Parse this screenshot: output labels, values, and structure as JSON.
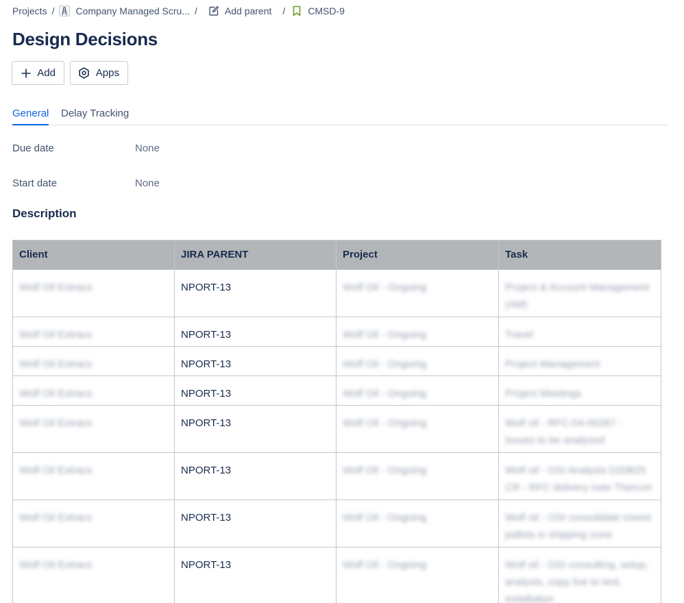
{
  "breadcrumb": {
    "projects": "Projects",
    "project_name": "Company Managed Scru...",
    "add_parent": "Add parent",
    "issue_key": "CMSD-9"
  },
  "page": {
    "title": "Design Decisions"
  },
  "toolbar": {
    "add_label": "Add",
    "apps_label": "Apps"
  },
  "tabs": [
    {
      "label": "General",
      "active": true
    },
    {
      "label": "Delay Tracking",
      "active": false
    }
  ],
  "fields": {
    "due_date": {
      "label": "Due date",
      "value": "None"
    },
    "start_date": {
      "label": "Start date",
      "value": "None"
    }
  },
  "description": {
    "heading": "Description",
    "table": {
      "headers": [
        "Client",
        "JIRA PARENT",
        "Project",
        "Task"
      ],
      "rows": [
        {
          "client": "Wolf Oil Extracs",
          "parent": "NPORT-13",
          "project": "Wolf Oil - Ongoing",
          "task": "Project & Account Management (AM)"
        },
        {
          "client": "Wolf Oil Extracs",
          "parent": "NPORT-13",
          "project": "Wolf Oil - Ongoing",
          "task": "Travel"
        },
        {
          "client": "Wolf Oil Extracs",
          "parent": "NPORT-13",
          "project": "Wolf Oil - Ongoing",
          "task": "Project Management"
        },
        {
          "client": "Wolf Oil Extracs",
          "parent": "NPORT-13",
          "project": "Wolf Oil - Ongoing",
          "task": "Project Meetings"
        },
        {
          "client": "Wolf Oil Extracs",
          "parent": "NPORT-13",
          "project": "Wolf Oil - Ongoing",
          "task": "Wolf oil - RFC-04-00287 - Issues to be analyzed"
        },
        {
          "client": "Wolf Oil Extracs",
          "parent": "NPORT-13",
          "project": "Wolf Oil - Ongoing",
          "task": "Wolf oil - OSI Analysis D20B25 CR - RFC delivery note Thercon"
        },
        {
          "client": "Wolf Oil Extracs",
          "parent": "NPORT-13",
          "project": "Wolf Oil - Ongoing",
          "task": "Wolf oil - OSI consolidate mixed pallets in shipping zone"
        },
        {
          "client": "Wolf Oil Extracs",
          "parent": "NPORT-13",
          "project": "Wolf Oil - Ongoing",
          "task": "Wolf oil - OSI consulting, setup, analysis, copy live to test, installation"
        }
      ]
    }
  },
  "colors": {
    "accent": "#0c66e4",
    "issue_icon": "#6a9a23",
    "header_bg": "#b3b6b8"
  },
  "icons": {
    "project": "project-avatar-icon",
    "add_parent": "pencil-edit-icon",
    "issue": "bookmark-icon",
    "add": "plus-icon",
    "apps": "hexagon-apps-icon"
  }
}
